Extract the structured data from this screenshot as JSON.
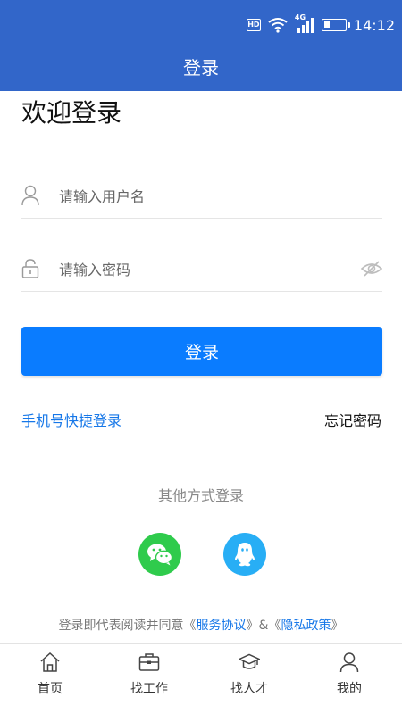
{
  "status_bar": {
    "hd_label": "HD",
    "network_label": "4G",
    "time": "14:12",
    "battery_level": 0.25
  },
  "header": {
    "title": "登录"
  },
  "login": {
    "welcome": "欢迎登录",
    "username_placeholder": "请输入用户名",
    "password_placeholder": "请输入密码",
    "submit_label": "登录",
    "quick_login_label": "手机号快捷登录",
    "forgot_password_label": "忘记密码",
    "other_methods_label": "其他方式登录",
    "social": [
      {
        "icon": "wechat-icon",
        "color": "#2fcb4c"
      },
      {
        "icon": "qq-icon",
        "color": "#28aef5"
      }
    ]
  },
  "agreement": {
    "prefix": "登录即代表阅读并同意《",
    "service_link": "服务协议",
    "joiner": "》&《",
    "privacy_link": "隐私政策",
    "suffix": "》"
  },
  "tabbar": {
    "items": [
      {
        "label": "首页",
        "icon": "home-icon"
      },
      {
        "label": "找工作",
        "icon": "briefcase-icon"
      },
      {
        "label": "找人才",
        "icon": "graduation-cap-icon"
      },
      {
        "label": "我的",
        "icon": "person-icon"
      }
    ]
  },
  "colors": {
    "header": "#3266c9",
    "primary_button": "#0a7cff",
    "link": "#1677e8"
  }
}
